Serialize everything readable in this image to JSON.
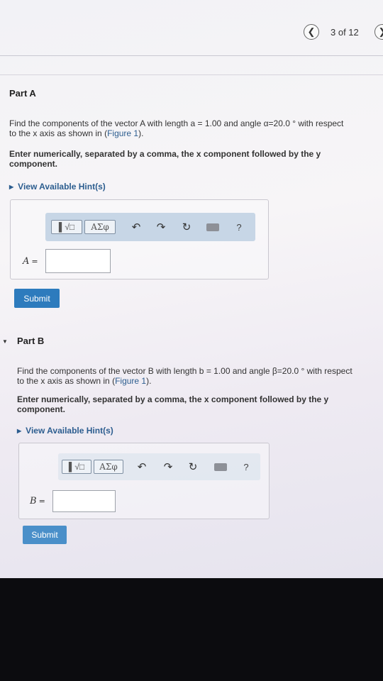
{
  "nav": {
    "prev_icon": "chevron-left-icon",
    "next_icon": "chevron-right-icon",
    "page_count": "3 of 12"
  },
  "partA": {
    "title": "Part A",
    "prompt_l1": "Find the components of the vector A with length a = 1.00 and angle α=20.0 ° with respect",
    "prompt_l2_pre": "to the x axis as shown in (",
    "figure_link": "Figure 1",
    "prompt_l2_post": ").",
    "instr_l1": "Enter numerically, separated by a comma, the x component followed by the y",
    "instr_l2": "component.",
    "hint": "View Available Hint(s)",
    "toolbar": {
      "templates": "▌√□",
      "greek": "ΑΣφ",
      "help": "?"
    },
    "label": "A",
    "eq": "=",
    "input_value": "",
    "submit": "Submit"
  },
  "partB": {
    "title": "Part B",
    "prompt_l1": "Find the components of the vector B with length b = 1.00 and angle β=20.0 ° with respect",
    "prompt_l2_pre": "to the x axis as shown in (",
    "figure_link": "Figure 1",
    "prompt_l2_post": ").",
    "instr_l1": "Enter numerically, separated by a comma, the x component followed by the y",
    "instr_l2": "component.",
    "hint": "View Available Hint(s)",
    "toolbar": {
      "templates": "▌√□",
      "greek": "ΑΣφ",
      "help": "?"
    },
    "label": "B",
    "eq": "=",
    "input_value": "",
    "submit": "Submit"
  },
  "colors": {
    "link": "#2c5d8f",
    "submit": "#2d7bbd",
    "toolbar": "#c7d6e6"
  }
}
